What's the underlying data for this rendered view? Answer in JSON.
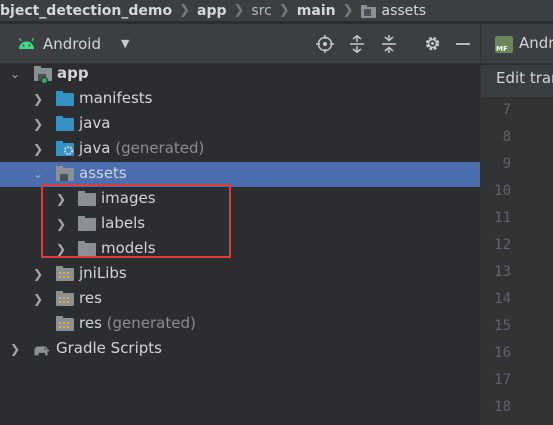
{
  "breadcrumb": {
    "items": [
      {
        "label": "bject_detection_demo",
        "style": "bold"
      },
      {
        "label": "app",
        "style": "bold"
      },
      {
        "label": "src",
        "style": "dim"
      },
      {
        "label": "main",
        "style": "bold"
      },
      {
        "label": "assets",
        "style": "plain",
        "icon": "folder-icon"
      }
    ]
  },
  "toolbar": {
    "title": "Android",
    "icons": [
      "target-icon",
      "expand-all-icon",
      "collapse-all-icon",
      "gear-icon",
      "minimize-icon"
    ]
  },
  "editor": {
    "tab_label": "Andr",
    "tab_badge": "MF",
    "notice": "Edit tran",
    "line_numbers": [
      "7",
      "8",
      "9",
      "10",
      "11",
      "12",
      "13",
      "14",
      "15",
      "16",
      "17",
      "18"
    ]
  },
  "tree": {
    "app": "app",
    "manifests": "manifests",
    "java": "java",
    "java_gen_name": "java",
    "java_gen_suffix": "(generated)",
    "assets": "assets",
    "images": "images",
    "labels": "labels",
    "models": "models",
    "jniLibs": "jniLibs",
    "res": "res",
    "res_gen_name": "res",
    "res_gen_suffix": "(generated)",
    "gradle": "Gradle Scripts"
  },
  "colors": {
    "selection": "#4b6eaf",
    "highlight_border": "#e23b3b",
    "source_folder": "#3592c4",
    "plain_folder": "#8a9096",
    "android_green": "#3ddc84"
  }
}
